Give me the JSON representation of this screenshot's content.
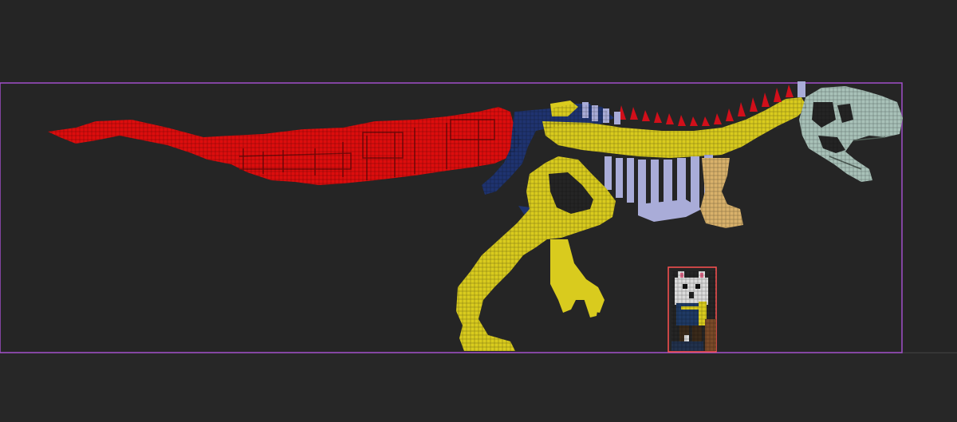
{
  "editor": {
    "background_color": "#252525",
    "ground_line_color": "#3c3c3c",
    "bounds_color": "#a24fc9",
    "selection_color": "#ff5252"
  },
  "skeleton": {
    "tail_color": "#dd0d0d",
    "hip_color": "#1f3470",
    "spine_color": "#d9cb1e",
    "rib_color": "#a9acd8",
    "shoulder_color": "#d9b26b",
    "skull_color": "#a9c2b9",
    "spike_color": "#d10f1a"
  },
  "character": {
    "fur_color": "#dcdcdc",
    "jacket_color": "#1f3a64",
    "boots_color": "#5a3a22"
  }
}
